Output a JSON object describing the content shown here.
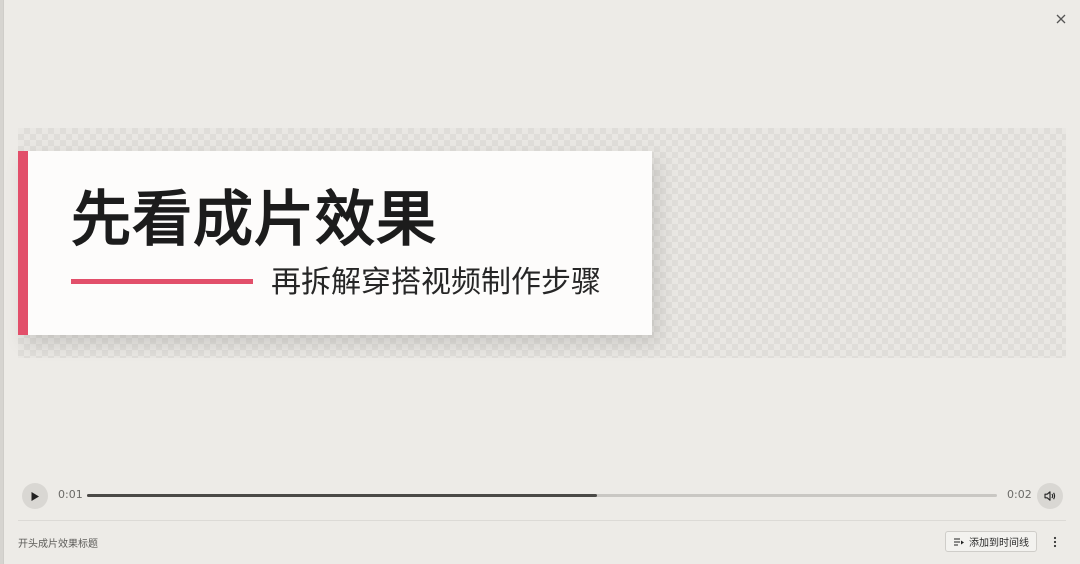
{
  "preview": {
    "main_title": "先看成片效果",
    "subtitle": "再拆解穿搭视频制作步骤"
  },
  "player": {
    "current_time": "0:01",
    "total_time": "0:02",
    "progress": 0.56
  },
  "footer": {
    "clip_name": "开头成片效果标题",
    "add_to_timeline_label": "添加到时间线"
  },
  "icons": {
    "close": "close-icon",
    "play": "play-icon",
    "volume": "volume-icon",
    "add_timeline": "add-to-timeline-icon",
    "more": "more-vertical-icon"
  },
  "colors": {
    "accent": "#e24f6a",
    "background": "#edebe7",
    "track": "#c9c7c3",
    "track_fill": "#4a4946"
  }
}
